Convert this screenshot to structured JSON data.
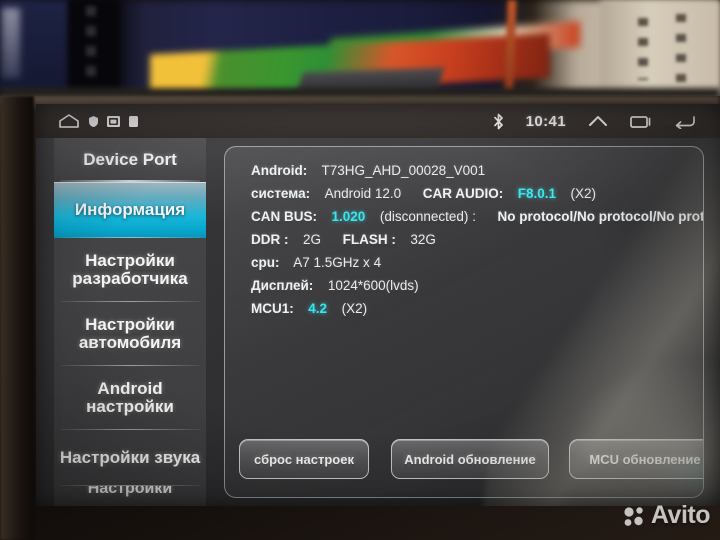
{
  "statusbar": {
    "time": "10:41",
    "icons_left": [
      "home-icon",
      "shield-notification-icon",
      "sdcard-notification-icon",
      "battery-notification-icon"
    ],
    "icons_right": [
      "bluetooth-icon",
      "chevron-up-icon",
      "recents-icon",
      "back-icon"
    ]
  },
  "sidebar": {
    "header": "Device Port",
    "items": [
      {
        "label": "Информация",
        "active": true
      },
      {
        "label": "Настройки\nразработчика",
        "active": false
      },
      {
        "label": "Настройки\nавтомобиля",
        "active": false
      },
      {
        "label": "Android\nнастройки",
        "active": false
      },
      {
        "label": "Настройки звука",
        "active": false
      },
      {
        "label": "Настройки",
        "active": false
      }
    ]
  },
  "info": {
    "android_key": "Android:",
    "android_value": "T73HG_AHD_00028_V001",
    "system_key": "система:",
    "system_value": "Android 12.0",
    "car_audio_key": "CAR AUDIO:",
    "car_audio_value": "F8.0.1",
    "car_audio_suffix": "(X2)",
    "canbus_key": "CAN BUS:",
    "canbus_value": "1.020",
    "canbus_state": "(disconnected)",
    "canbus_sep": ":",
    "canbus_protocol": "No protocol/No protocol/No prot",
    "ddr_key": "DDR :",
    "ddr_value": "2G",
    "flash_key": "FLASH :",
    "flash_value": "32G",
    "cpu_key": "cpu:",
    "cpu_value": "A7 1.5GHz x 4",
    "display_key": "Дисплей:",
    "display_value": "1024*600(lvds)",
    "mcu1_key": "MCU1:",
    "mcu1_value": "4.2",
    "mcu1_suffix": "(X2)"
  },
  "buttons": {
    "reset": "сброс настроек",
    "android_update": "Android обновление",
    "mcu_update": "MCU обновление"
  },
  "watermark": {
    "text": "Avito"
  },
  "colors": {
    "accent_cyan": "#36e6ef",
    "active_tab": "#17b6d8",
    "panel_border": "#e4eef4",
    "text": "#eef2f4"
  }
}
